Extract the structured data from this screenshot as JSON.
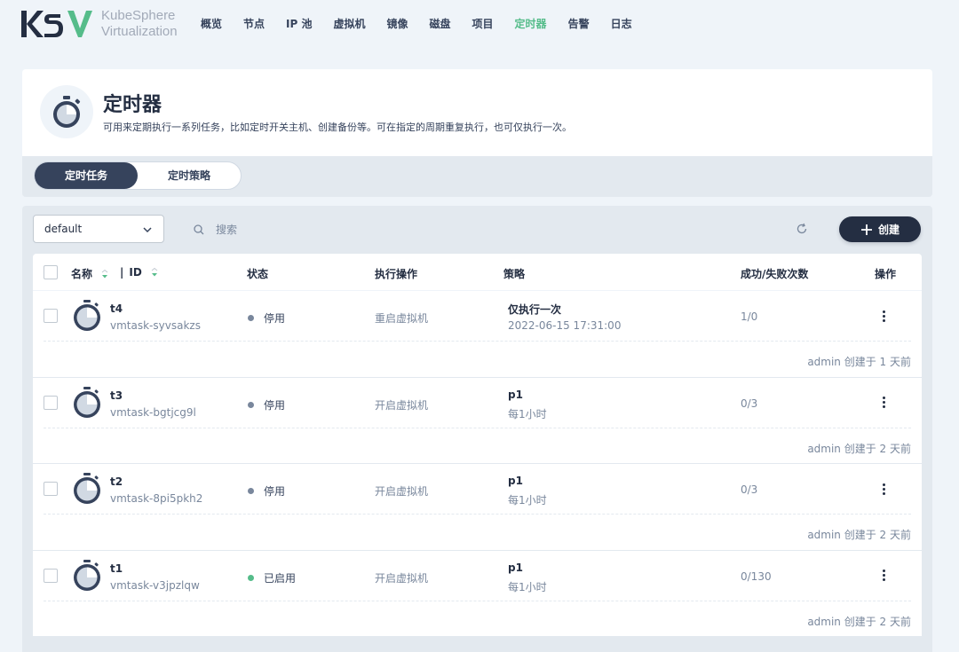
{
  "brand": {
    "logo_text_line1": "KubeSphere",
    "logo_text_line2": "Virtualization",
    "logo_letters": "KSV",
    "accent": "#55bc8a",
    "dark": "#242e42"
  },
  "nav": {
    "items": [
      {
        "label": "概览"
      },
      {
        "label": "节点"
      },
      {
        "label": "IP 池"
      },
      {
        "label": "虚拟机"
      },
      {
        "label": "镜像"
      },
      {
        "label": "磁盘"
      },
      {
        "label": "项目"
      },
      {
        "label": "定时器",
        "active": true
      },
      {
        "label": "告警"
      },
      {
        "label": "日志"
      }
    ]
  },
  "header": {
    "icon": "stopwatch-icon",
    "title": "定时器",
    "description": "可用来定期执行一系列任务，比如定时开关主机、创建备份等。可在指定的周期重复执行，也可仅执行一次。"
  },
  "tabs": [
    {
      "label": "定时任务",
      "active": true
    },
    {
      "label": "定时策略",
      "active": false
    }
  ],
  "toolbar": {
    "namespace": "default",
    "search_placeholder": "搜索",
    "create_label": "创建"
  },
  "table": {
    "headers": {
      "name": "名称",
      "id": "ID",
      "status": "状态",
      "action": "执行操作",
      "strategy": "策略",
      "count": "成功/失败次数",
      "ops": "操作"
    },
    "rows": [
      {
        "name": "t4",
        "id": "vmtask-syvsakzs",
        "status": "停用",
        "status_color": "#79879c",
        "action": "重启虚拟机",
        "strategy": "仅执行一次",
        "strategy_detail": "2022-06-15 17:31:00",
        "count": "1/0",
        "creator": "admin 创建于 1 天前"
      },
      {
        "name": "t3",
        "id": "vmtask-bgtjcg9l",
        "status": "停用",
        "status_color": "#79879c",
        "action": "开启虚拟机",
        "strategy": "p1",
        "strategy_detail": "每1小时",
        "count": "0/3",
        "creator": "admin 创建于 2 天前"
      },
      {
        "name": "t2",
        "id": "vmtask-8pi5pkh2",
        "status": "停用",
        "status_color": "#79879c",
        "action": "开启虚拟机",
        "strategy": "p1",
        "strategy_detail": "每1小时",
        "count": "0/3",
        "creator": "admin 创建于 2 天前"
      },
      {
        "name": "t1",
        "id": "vmtask-v3jpzlqw",
        "status": "已启用",
        "status_color": "#55bc8a",
        "action": "开启虚拟机",
        "strategy": "p1",
        "strategy_detail": "每1小时",
        "count": "0/130",
        "creator": "admin 创建于 2 天前"
      }
    ]
  }
}
